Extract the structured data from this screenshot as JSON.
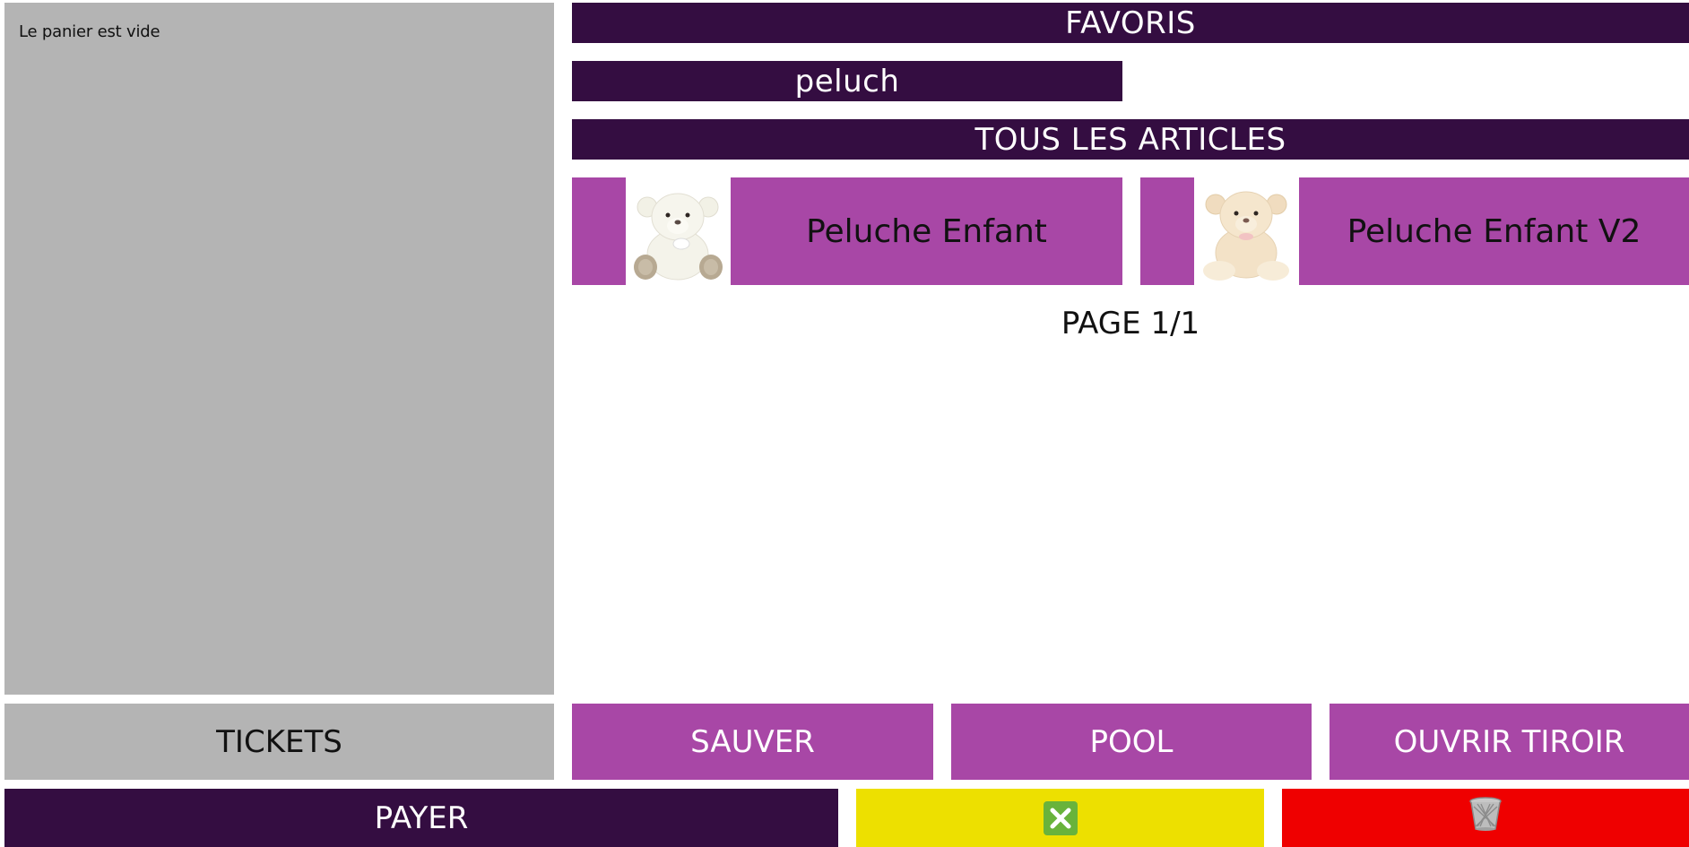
{
  "cart": {
    "empty_text": "Le panier est vide"
  },
  "header": {
    "favorites_label": "FAVORIS",
    "search_value": "peluch",
    "all_items_label": "TOUS LES ARTICLES"
  },
  "products": [
    {
      "name": "Peluche Enfant",
      "image": "white-teddy-bear"
    },
    {
      "name": "Peluche Enfant V2",
      "image": "cream-teddy-bear"
    }
  ],
  "pagination": {
    "label": "PAGE 1/1"
  },
  "actions": {
    "tickets_label": "TICKETS",
    "save_label": "SAUVER",
    "pool_label": "POOL",
    "open_drawer_label": "OUVRIR TIROIR",
    "pay_label": "PAYER"
  },
  "icons": {
    "cancel": "close-box-icon",
    "delete": "trash-basket-icon"
  },
  "colors": {
    "dark_purple": "#340d41",
    "purple": "#a847a6",
    "grey": "#b4b4b4",
    "yellow": "#ede000",
    "red": "#ef0000",
    "green": "#69b33b"
  }
}
